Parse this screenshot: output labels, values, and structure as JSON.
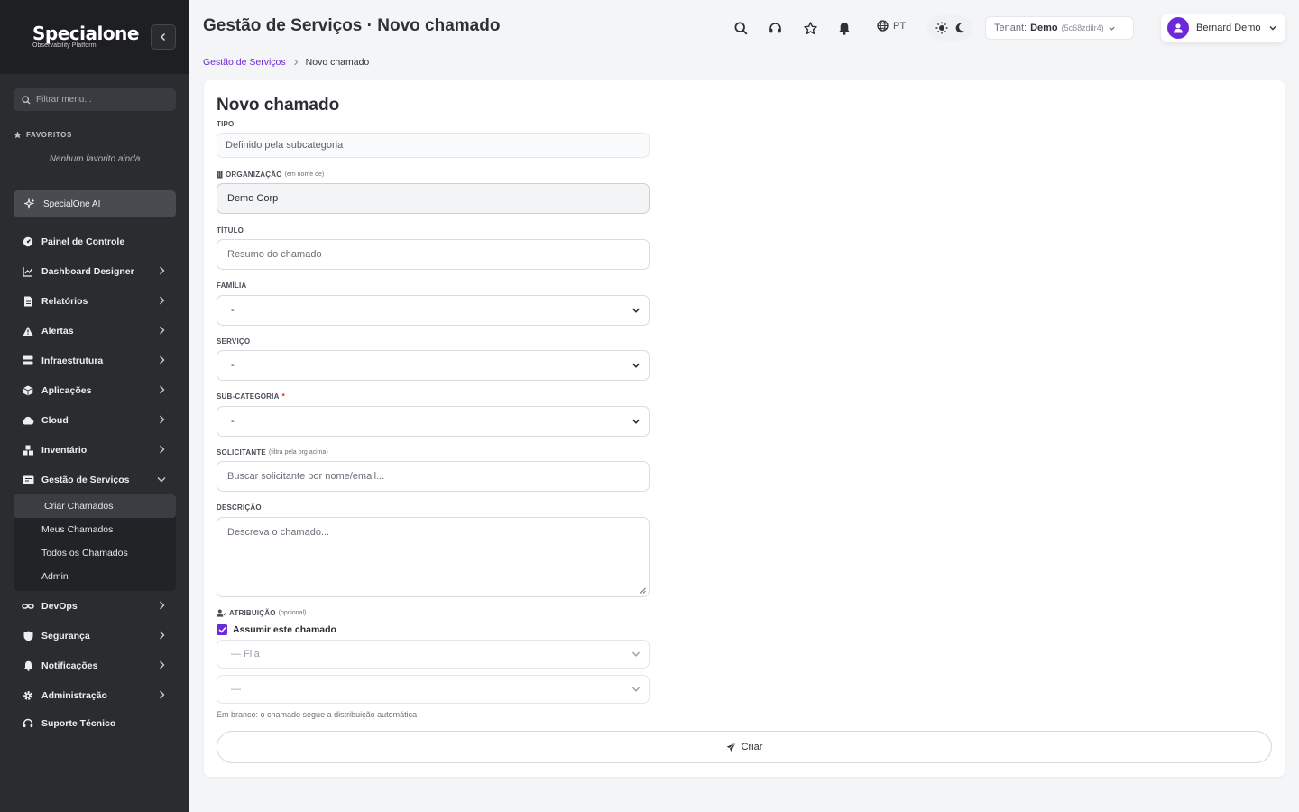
{
  "sidebar": {
    "logo_main": "Specialone",
    "logo_sub": "Observability Platform",
    "filter_placeholder": "Filtrar menu...",
    "favorites_label": "FAVORITOS",
    "favorites_empty": "Nenhum favorito ainda",
    "ai_label": "SpecialOne AI",
    "items": [
      {
        "label": "Painel de Controle",
        "icon": "dashboard-gauge-icon"
      },
      {
        "label": "Dashboard Designer",
        "icon": "chart-line-icon"
      },
      {
        "label": "Relatórios",
        "icon": "document-icon"
      },
      {
        "label": "Alertas",
        "icon": "warning-triangle-icon"
      },
      {
        "label": "Infraestrutura",
        "icon": "server-icon"
      },
      {
        "label": "Aplicações",
        "icon": "box-icon"
      },
      {
        "label": "Cloud",
        "icon": "cloud-icon"
      },
      {
        "label": "Inventário",
        "icon": "boxes-icon"
      },
      {
        "label": "Gestão de Serviços",
        "icon": "ticket-icon"
      }
    ],
    "sub_items": [
      "Criar Chamados",
      "Meus Chamados",
      "Todos os Chamados",
      "Admin"
    ],
    "items_after": [
      {
        "label": "DevOps",
        "icon": "infinity-icon"
      },
      {
        "label": "Segurança",
        "icon": "shield-icon"
      },
      {
        "label": "Notificações",
        "icon": "bell-icon"
      },
      {
        "label": "Administração",
        "icon": "gear-icon"
      },
      {
        "label": "Suporte Técnico",
        "icon": "headset-icon"
      }
    ]
  },
  "header": {
    "title": "Gestão de Serviços · Novo chamado",
    "language": "PT",
    "tenant_label": "Tenant:",
    "tenant_name": "Demo",
    "tenant_id": "(5c68zdilr4)",
    "user_name": "Bernard Demo"
  },
  "breadcrumb": {
    "parent": "Gestão de Serviços",
    "current": "Novo chamado"
  },
  "form": {
    "title": "Novo chamado",
    "tipo_label": "TIPO",
    "tipo_value": "Definido pela subcategoria",
    "org_label": "ORGANIZAÇÃO",
    "org_hint": "(em nome de)",
    "org_value": "Demo Corp",
    "titulo_label": "TÍTULO",
    "titulo_placeholder": "Resumo do chamado",
    "familia_label": "FAMÍLIA",
    "familia_value": "-",
    "servico_label": "SERVIÇO",
    "servico_value": "-",
    "subcat_label": "SUB-CATEGORIA",
    "subcat_required": "*",
    "subcat_value": "-",
    "solicitante_label": "SOLICITANTE",
    "solicitante_hint": "(filtra pela org acima)",
    "solicitante_placeholder": "Buscar solicitante por nome/email...",
    "descricao_label": "DESCRIÇÃO",
    "descricao_placeholder": "Descreva o chamado...",
    "atribuicao_label": "ATRIBUIÇÃO",
    "atribuicao_hint": "(opcional)",
    "assumir_label": "Assumir este chamado",
    "assumir_checked": true,
    "fila_value": "— Fila",
    "agent_value": "—",
    "help_text": "Em branco: o chamado segue a distribuição automática",
    "submit_label": "Criar"
  },
  "colors": {
    "accent": "#6d28d9",
    "sidebar_bg": "#2b2c30",
    "required": "#dc2626"
  }
}
